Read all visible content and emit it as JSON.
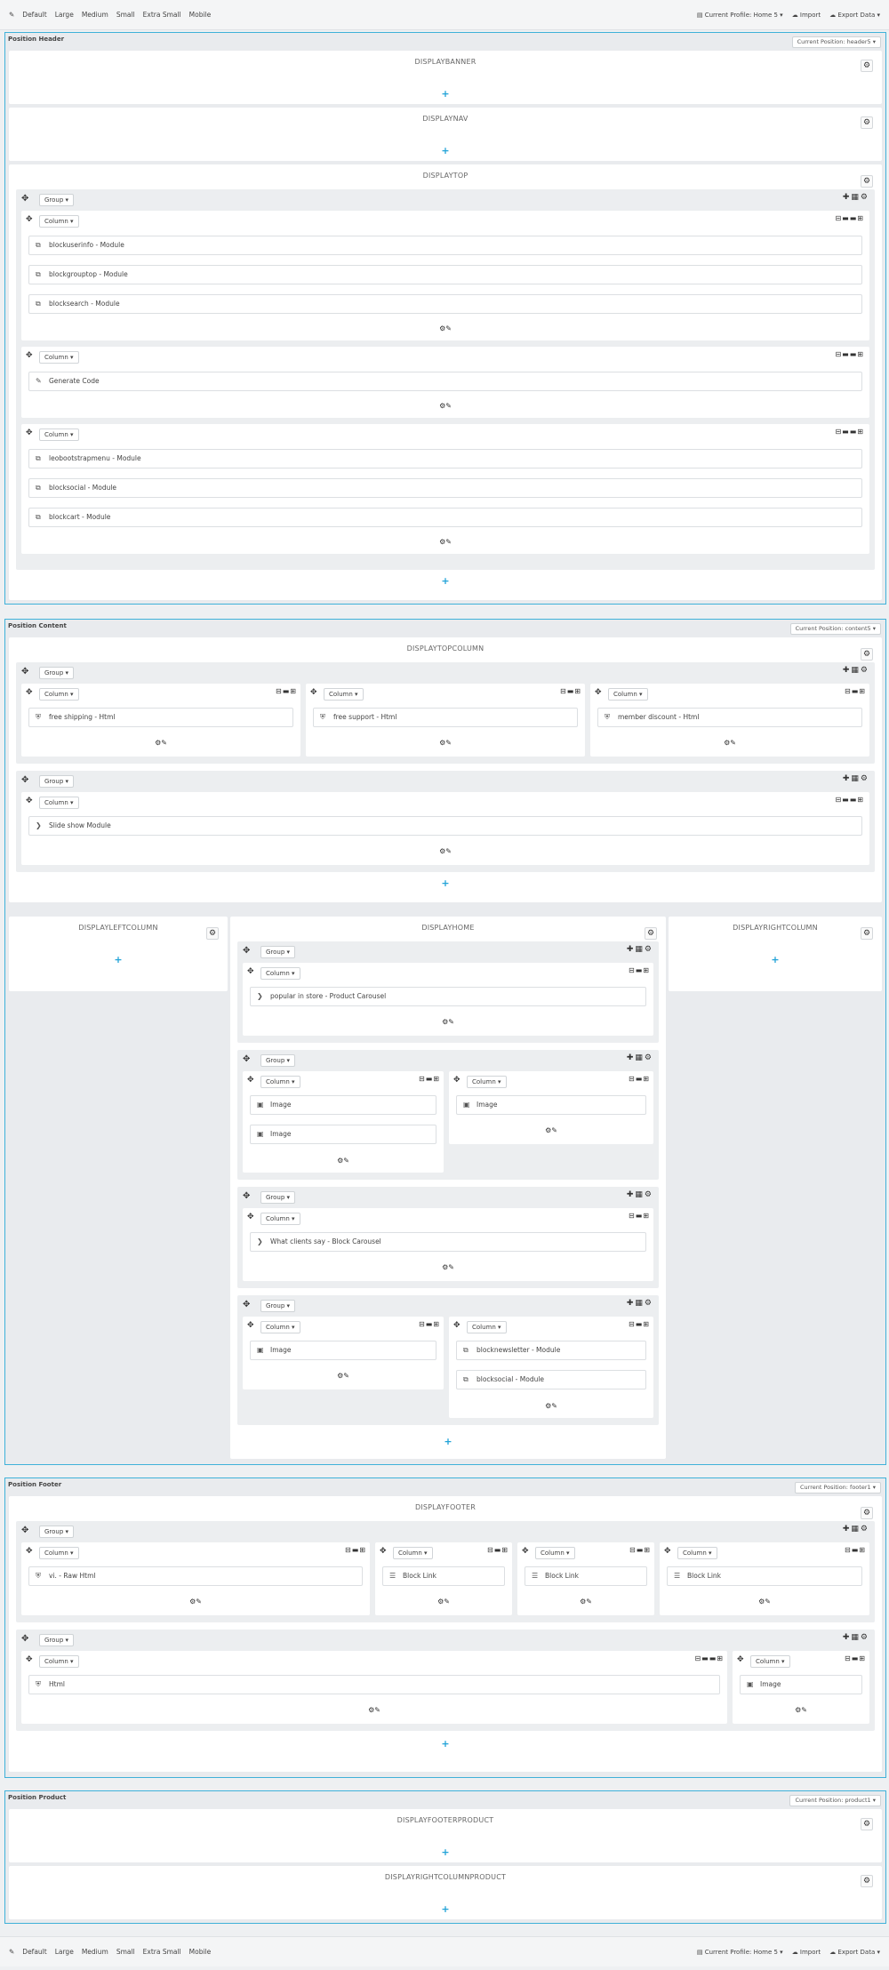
{
  "toolbar": {
    "edit_icon": "pencil-icon",
    "items": [
      "Default",
      "Large",
      "Medium",
      "Small",
      "Extra Small",
      "Mobile"
    ],
    "profile": "Current Profile: Home 5",
    "profile_bottom": "Current Profile: Home 5",
    "import": "Import",
    "export": "Export Data"
  },
  "sections": {
    "header": {
      "title": "Position Header",
      "position": "Current Position: header5"
    },
    "content": {
      "title": "Position Content",
      "position": "Current Position: content5"
    },
    "footer": {
      "title": "Position Footer",
      "position": "Current Position: footer1"
    },
    "product": {
      "title": "Position Product",
      "position": "Current Position: product1"
    }
  },
  "hooks": {
    "displaybanner": "DISPLAYBANNER",
    "displaynav": "DISPLAYNAV",
    "displaytop": "DISPLAYTOP",
    "displaytopcolumn": "DISPLAYTOPCOLUMN",
    "displayleftcolumn": "DISPLAYLEFTCOLUMN",
    "displayhome": "DISPLAYHOME",
    "displayrightcolumn": "DISPLAYRIGHTCOLUMN",
    "displayfooter": "DISPLAYFOOTER",
    "displayfooterproduct": "DISPLAYFOOTERPRODUCT",
    "displayrightcolumnproduct": "DISPLAYRIGHTCOLUMNPRODUCT"
  },
  "labels": {
    "group": "Group ▾",
    "column": "Column ▾"
  },
  "widgets": {
    "top": [
      "blockuserinfo - Module",
      "blockgrouptop - Module",
      "blocksearch - Module",
      "Generate Code",
      "leobootstrapmenu - Module",
      "blocksocial - Module",
      "blockcart - Module"
    ],
    "topcolumn": [
      "free shipping - Html",
      "free support - Html",
      "member discount - Html",
      "Slide show Module"
    ],
    "home": [
      "popular in store - Product Carousel",
      "Image",
      "Image",
      "Image",
      "What clients say - Block Carousel",
      "Image",
      "blocknewsletter - Module",
      "blocksocial - Module"
    ],
    "footer": [
      "vi. - Raw Html",
      "Block Link",
      "Block Link",
      "Block Link",
      "Html",
      "Image"
    ]
  }
}
